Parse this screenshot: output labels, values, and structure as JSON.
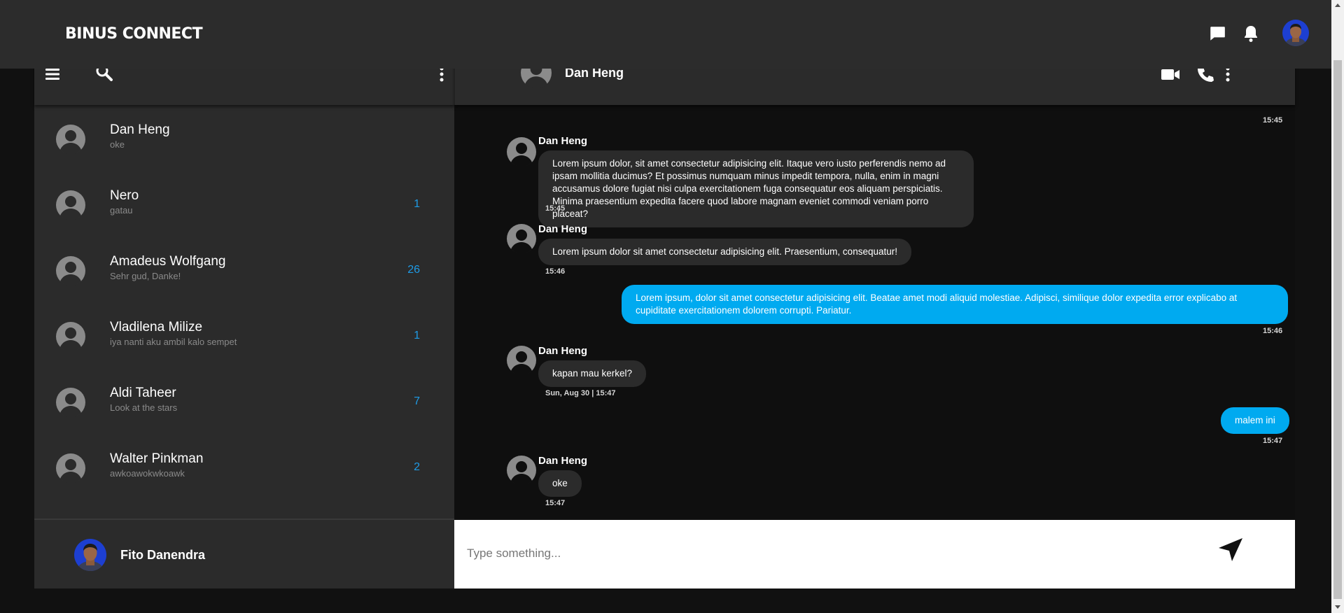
{
  "app": {
    "brand": "BINUS CONNECT"
  },
  "sidebar": {
    "contacts": [
      {
        "name": "Dan Heng",
        "preview": "oke",
        "unread": ""
      },
      {
        "name": "Nero",
        "preview": "gatau",
        "unread": "1"
      },
      {
        "name": "Amadeus Wolfgang",
        "preview": "Sehr gud, Danke!",
        "unread": "26"
      },
      {
        "name": "Vladilena Milize",
        "preview": "iya nanti aku ambil kalo sempet",
        "unread": "1"
      },
      {
        "name": "Aldi Taheer",
        "preview": "Look at the stars",
        "unread": "7"
      },
      {
        "name": "Walter Pinkman",
        "preview": "awkoawokwkoawk",
        "unread": "2"
      }
    ],
    "current_user": "Fito Danendra"
  },
  "chat": {
    "contact_name": "Dan Heng",
    "messages": [
      {
        "dir": "out",
        "text": "...",
        "time": "15:45"
      },
      {
        "dir": "in",
        "sender": "Dan Heng",
        "text": "Lorem ipsum dolor, sit amet consectetur adipisicing elit. Itaque vero iusto perferendis nemo ad ipsam mollitia ducimus? Et possimus numquam minus impedit tempora, nulla, enim in magni accusamus dolore fugiat nisi culpa exercitationem fuga consequatur eos aliquam perspiciatis. Minima praesentium expedita facere quod labore magnam eveniet commodi veniam porro placeat?",
        "time": "15:45"
      },
      {
        "dir": "in",
        "sender": "Dan Heng",
        "text": "Lorem ipsum dolor sit amet consectetur adipisicing elit. Praesentium, consequatur!",
        "time": "15:46"
      },
      {
        "dir": "out",
        "text": "Lorem ipsum, dolor sit amet consectetur adipisicing elit. Beatae amet modi aliquid molestiae. Adipisci, similique dolor expedita error explicabo at cupiditate exercitationem dolorem corrupti. Pariatur.",
        "time": "15:46"
      },
      {
        "dir": "in",
        "sender": "Dan Heng",
        "text": "kapan mau kerkel?",
        "time": "Sun, Aug 30 | 15:47"
      },
      {
        "dir": "out",
        "text": "malem ini",
        "time": "15:47"
      },
      {
        "dir": "in",
        "sender": "Dan Heng",
        "text": "oke",
        "time": "15:47"
      }
    ]
  },
  "composer": {
    "placeholder": "Type something..."
  },
  "colors": {
    "accent": "#00aaf0",
    "badge": "#1e9be6",
    "panel": "#2b2b2b",
    "chat_bg": "#0f0f0f",
    "topbar": "#2c2c2c"
  },
  "icons": {
    "top": [
      "chat-bubble-icon",
      "bell-icon",
      "user-avatar"
    ],
    "sidebar_header": [
      "hamburger-menu-icon",
      "search-icon",
      "more-vertical-icon"
    ],
    "chat_header": [
      "video-camera-icon",
      "phone-icon",
      "more-vertical-icon"
    ],
    "composer": [
      "send-arrow-icon"
    ]
  }
}
